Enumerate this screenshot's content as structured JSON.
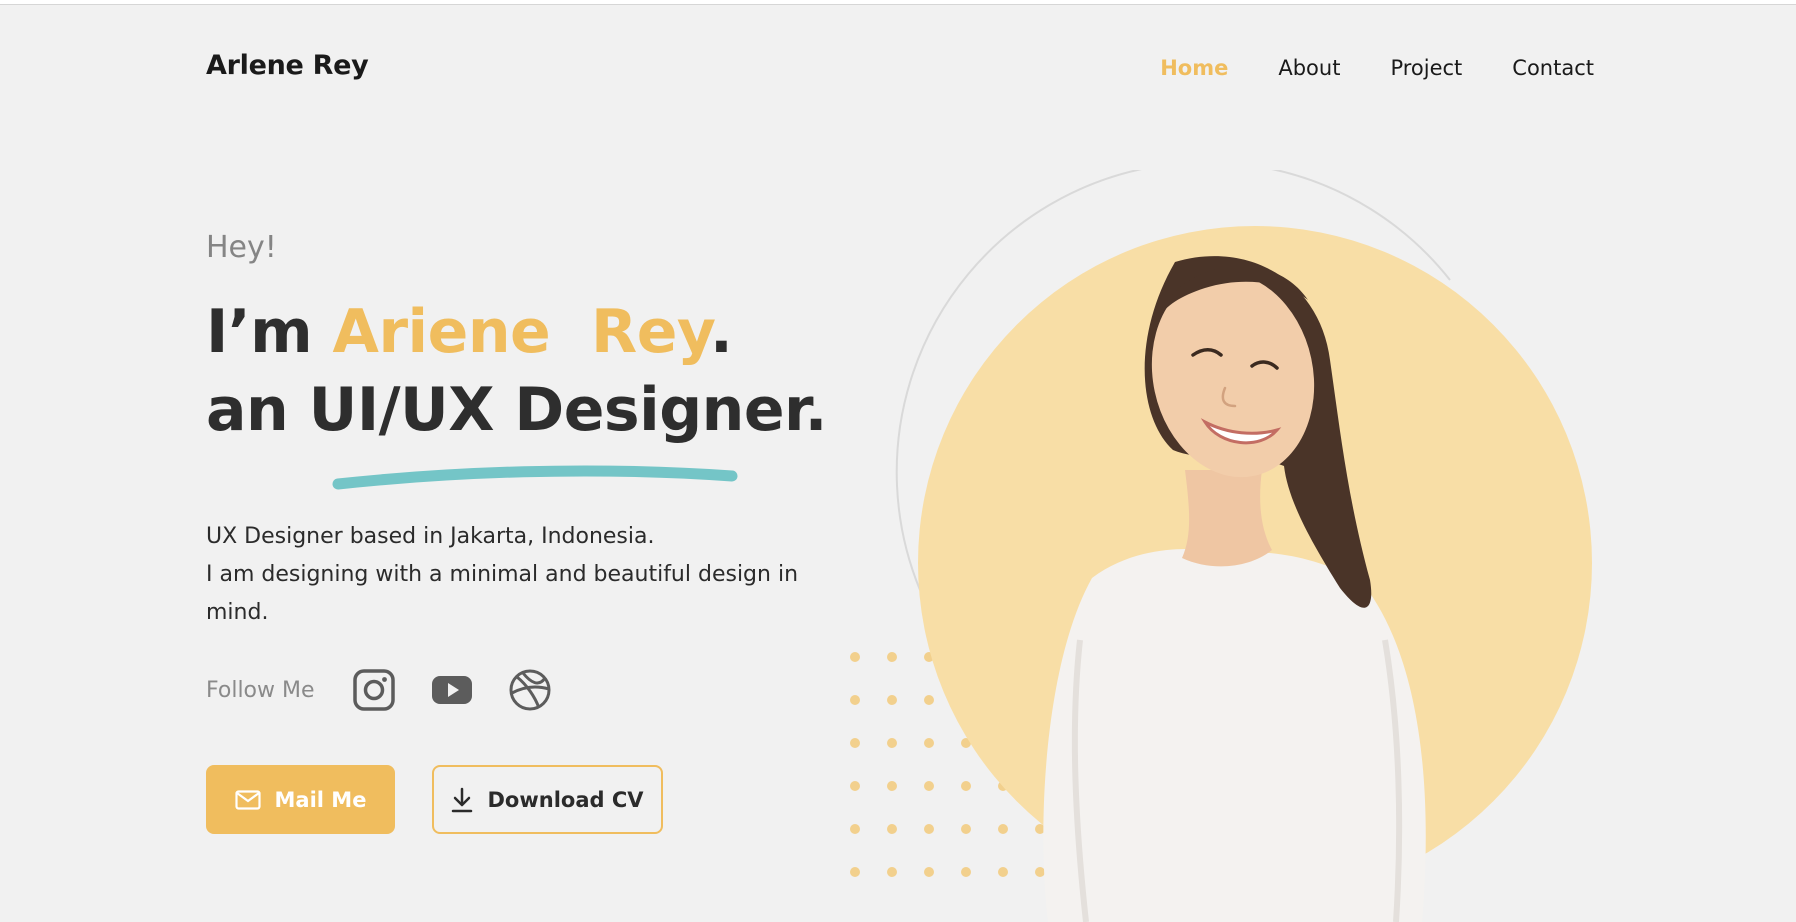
{
  "header": {
    "logo": "Arlene Rey",
    "nav": [
      "Home",
      "About",
      "Project",
      "Contact"
    ]
  },
  "hero": {
    "greeting": "Hey!",
    "line1_prefix": "I’m ",
    "line1_name": "Ariene  Rey",
    "line1_suffix": ".",
    "line2": "an UI/UX Designer.",
    "description": [
      "UX Designer based in Jakarta, Indonesia.",
      "I am designing with a minimal and beautiful design in mind."
    ],
    "follow_label": "Follow Me",
    "social_icons": [
      "instagram-icon",
      "youtube-icon",
      "dribbble-icon"
    ],
    "buttons": {
      "mail": "Mail Me",
      "cv": "Download CV"
    }
  },
  "colors": {
    "accent": "#f0bd5e",
    "accent_light": "#f8dea6",
    "underline": "#74c5c7",
    "background": "#f1f1f1"
  }
}
